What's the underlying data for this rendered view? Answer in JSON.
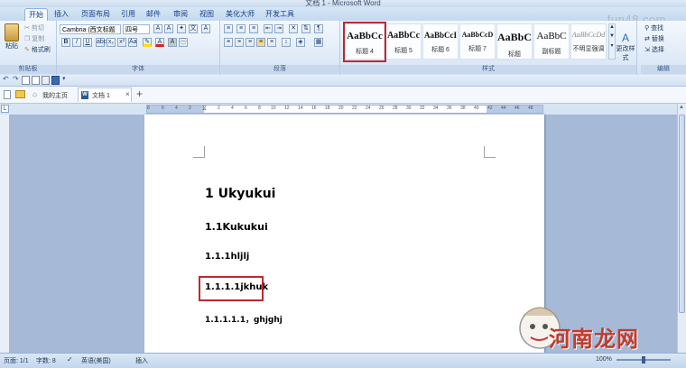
{
  "window": {
    "title": "文档 1 - Microsoft Word",
    "watermark_top": "fun48.com"
  },
  "tabs": [
    "开始",
    "插入",
    "页面布局",
    "引用",
    "邮件",
    "审阅",
    "视图",
    "美化大师",
    "开发工具"
  ],
  "clipboard": {
    "paste": "粘贴",
    "cut": "剪切",
    "copy": "复制",
    "format_painter": "格式刷",
    "label": "剪贴板"
  },
  "font": {
    "name": "Cambria (西文标题",
    "size": "四号",
    "label": "字体",
    "bold": "B",
    "italic": "I",
    "underline": "U"
  },
  "paragraph": {
    "label": "段落"
  },
  "styles": {
    "label": "样式",
    "items": [
      {
        "sample": "AaBbCc",
        "name": "标题 4"
      },
      {
        "sample": "AaBbCc",
        "name": "标题 5"
      },
      {
        "sample": "AaBbCcI",
        "name": "标题 6"
      },
      {
        "sample": "AaBbCcD",
        "name": "标题 7"
      },
      {
        "sample": "AaBbC",
        "name": "标题"
      },
      {
        "sample": "AaBbC",
        "name": "副标题"
      },
      {
        "sample": "AaBbCcDd",
        "name": "不明显强调"
      }
    ],
    "change": "更改样式"
  },
  "editing": {
    "find": "查找",
    "replace": "替换",
    "select": "选择",
    "label": "编辑"
  },
  "doc_tabs": [
    {
      "label": "我的主页"
    },
    {
      "label": "文档 1"
    }
  ],
  "ruler_numbers": [
    "8",
    "6",
    "4",
    "2",
    "",
    "2",
    "4",
    "6",
    "8",
    "10",
    "12",
    "14",
    "16",
    "18",
    "20",
    "22",
    "24",
    "26",
    "28",
    "30",
    "32",
    "34",
    "36",
    "38",
    "40",
    "42",
    "44",
    "46",
    "48"
  ],
  "document": {
    "h1": "1 Ukyukui",
    "h2": "1.1Kukukui",
    "h3": "1.1.1hljlj",
    "h4": "1.1.1.1jkhuk",
    "h5": "1.1.1.1.1，ghjghj"
  },
  "status": {
    "page": "页面: 1/1",
    "words": "字数: 8",
    "lang": "英语(美国)",
    "mode": "插入",
    "zoom": "100%"
  },
  "watermark_bottom": "河南龙网",
  "colors": {
    "highlight_red": "#c0282f",
    "ribbon_blue": "#dfe9f5"
  }
}
